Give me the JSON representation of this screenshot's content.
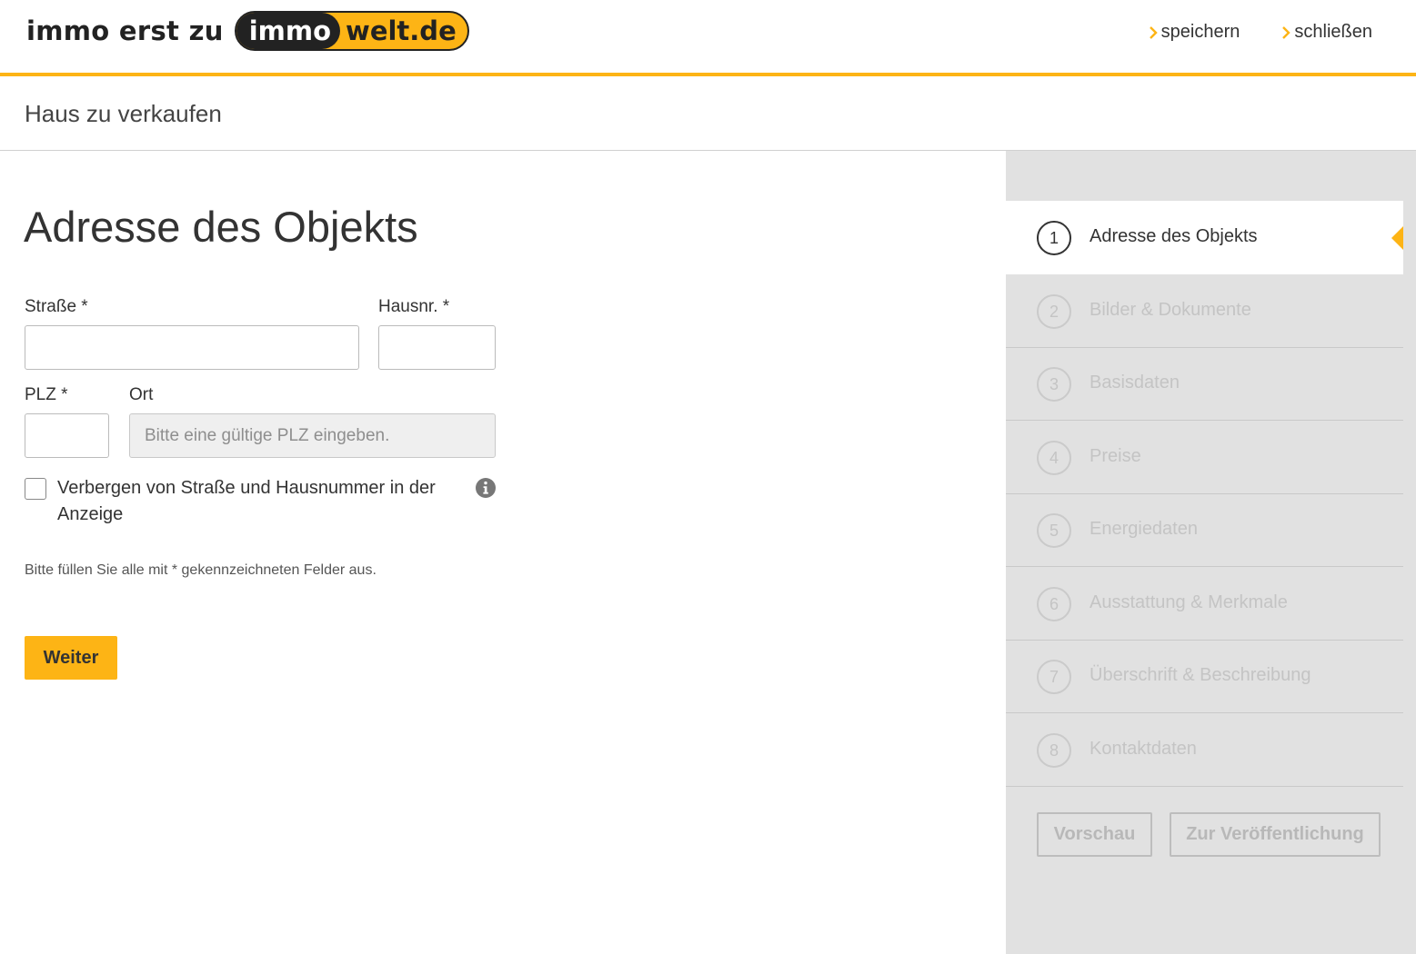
{
  "colors": {
    "accent": "#fdb415",
    "text": "#333333",
    "sidebar_bg": "#e1e1e1",
    "inactive_step": "#c4c4c4"
  },
  "header": {
    "tagline": "immo erst zu",
    "logo_dark": "immo",
    "logo_light": "welt.de",
    "links": [
      {
        "label": "speichern",
        "icon": "chevron-right-icon"
      },
      {
        "label": "schließen",
        "icon": "chevron-right-icon"
      }
    ]
  },
  "subheader": {
    "title": "Haus zu verkaufen"
  },
  "form": {
    "title": "Adresse des Objekts",
    "street_label": "Straße *",
    "street_value": "",
    "house_no_label": "Hausnr. *",
    "house_no_value": "",
    "zip_label": "PLZ *",
    "zip_value": "",
    "city_label": "Ort",
    "city_placeholder": "Bitte eine gültige PLZ eingeben.",
    "hide_address_label": "Verbergen von Straße und Hausnummer in der Anzeige",
    "hide_address_checked": false,
    "info_icon": "info-icon",
    "hint": "Bitte füllen Sie alle mit * gekennzeichneten Felder aus.",
    "next_label": "Weiter"
  },
  "steps": [
    {
      "number": "1",
      "label": "Adresse des Objekts",
      "active": true
    },
    {
      "number": "2",
      "label": "Bilder & Dokumente",
      "active": false
    },
    {
      "number": "3",
      "label": "Basisdaten",
      "active": false
    },
    {
      "number": "4",
      "label": "Preise",
      "active": false
    },
    {
      "number": "5",
      "label": "Energiedaten",
      "active": false
    },
    {
      "number": "6",
      "label": "Ausstattung & Merkmale",
      "active": false
    },
    {
      "number": "7",
      "label": "Überschrift & Beschreibung",
      "active": false
    },
    {
      "number": "8",
      "label": "Kontaktdaten",
      "active": false
    }
  ],
  "sidebar_actions": {
    "preview_label": "Vorschau",
    "publish_label": "Zur Veröffentlichung"
  }
}
